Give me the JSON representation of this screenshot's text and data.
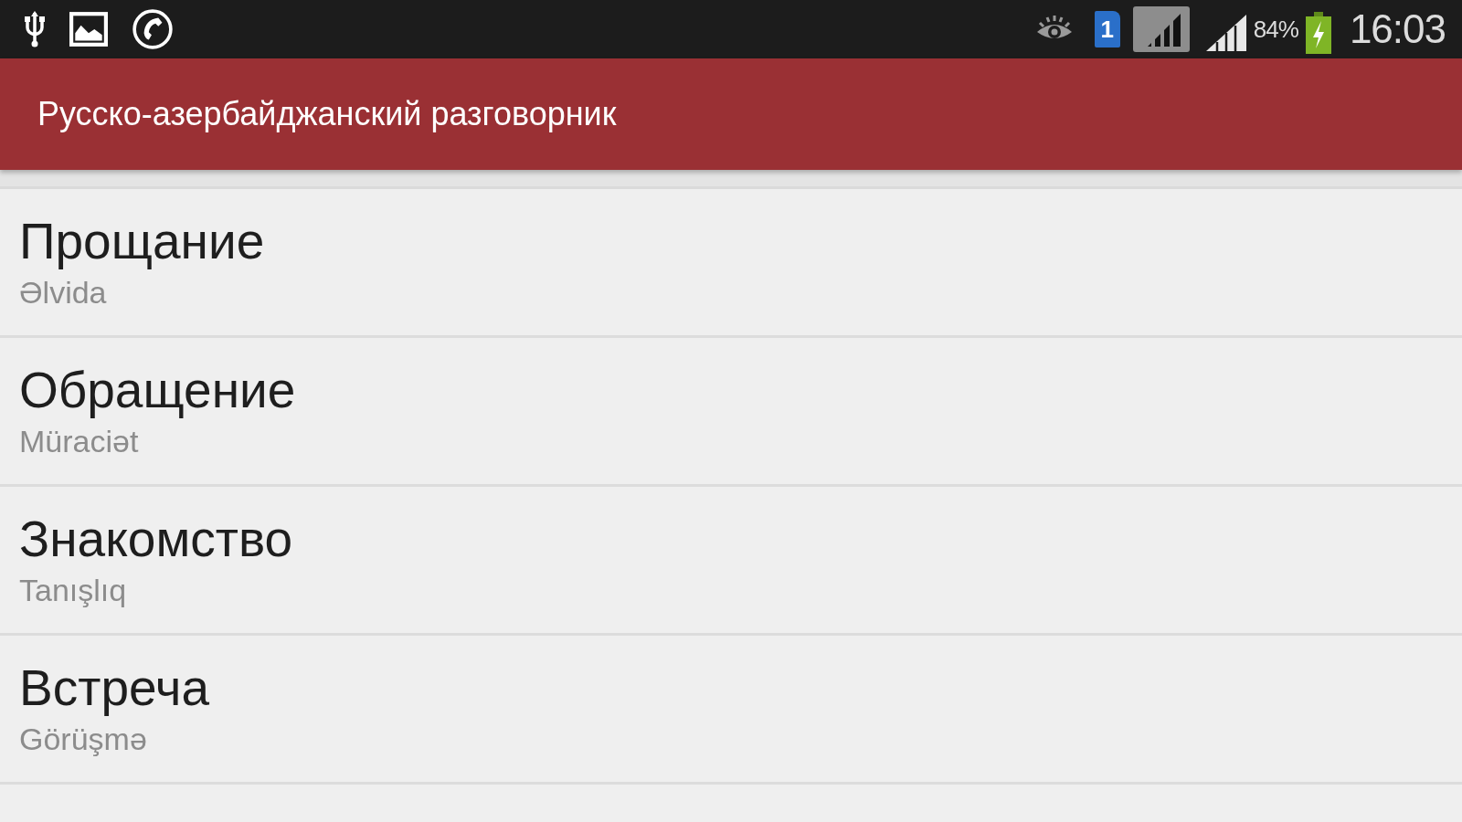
{
  "status_bar": {
    "sim_label": "1",
    "battery_text": "84%",
    "time": "16:03"
  },
  "app_bar": {
    "title": "Русско-азербайджанский разговорник"
  },
  "items": [
    {
      "title": "Прощание",
      "subtitle": "Əlvida"
    },
    {
      "title": "Обращение",
      "subtitle": "Müraciət"
    },
    {
      "title": "Знакомство",
      "subtitle": "Tanışlıq"
    },
    {
      "title": "Встреча",
      "subtitle": "Görüşmə"
    }
  ]
}
